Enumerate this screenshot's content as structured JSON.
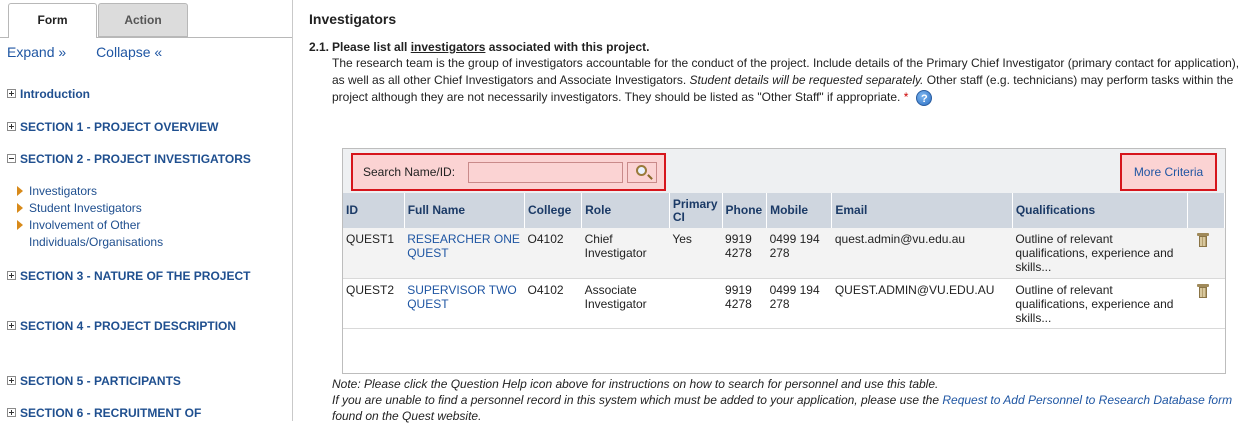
{
  "sidebar": {
    "tabs": {
      "form": "Form",
      "action": "Action"
    },
    "expand": "Expand »",
    "collapse": "Collapse «",
    "sections": [
      {
        "label": "Introduction"
      },
      {
        "label": "SECTION 1 - PROJECT OVERVIEW"
      },
      {
        "label": "SECTION 2 - PROJECT INVESTIGATORS"
      },
      {
        "label": "SECTION 3 - NATURE OF THE PROJECT"
      },
      {
        "label": "SECTION 4 - PROJECT DESCRIPTION"
      },
      {
        "label": "SECTION 5 - PARTICIPANTS"
      },
      {
        "label": "SECTION 6 - RECRUITMENT OF"
      }
    ],
    "sub_items": [
      "Investigators",
      "Student Investigators",
      "Involvement of Other",
      "Individuals/Organisations"
    ]
  },
  "main": {
    "title": "Investigators",
    "question": {
      "number": "2.1.",
      "title_pre": "Please list all ",
      "title_link": "investigators",
      "title_post": " associated with this project.",
      "body_1": "The research team is the group of investigators accountable for the conduct of the project. Include details of the Primary Chief Investigator (primary contact for application), as well as all other Chief Investigators and Associate Investigators. ",
      "body_italic": "Student details will be requested separately.",
      "body_2": " Other staff (e.g. technicians) may perform tasks within the project although they are not necessarily investigators. They should be listed as \"Other Staff\" if appropriate. ",
      "required_mark": "*",
      "help_glyph": "?"
    },
    "search": {
      "label": "Search Name/ID:",
      "value": "",
      "more_criteria": "More Criteria"
    },
    "table": {
      "headers": [
        "ID",
        "Full Name",
        "College",
        "Role",
        "Primary CI",
        "Phone",
        "Mobile",
        "Email",
        "Qualifications",
        ""
      ],
      "rows": [
        {
          "id": "QUEST1",
          "name": "RESEARCHER ONE QUEST",
          "college": "O4102",
          "role": "Chief Investigator",
          "primary": "Yes",
          "phone": "9919 4278",
          "mobile": "0499 194 278",
          "email": "quest.admin@vu.edu.au",
          "qual": "Outline of relevant qualifications, experience and skills..."
        },
        {
          "id": "QUEST2",
          "name": "SUPERVISOR TWO QUEST",
          "college": "O4102",
          "role": "Associate Investigator",
          "primary": "",
          "phone": "9919 4278",
          "mobile": "0499 194 278",
          "email": "QUEST.ADMIN@VU.EDU.AU",
          "qual": "Outline of relevant qualifications, experience and skills..."
        }
      ]
    },
    "note": {
      "line1": "Note: Please click the Question Help icon above for instructions on how to search for personnel and use this table.",
      "line2_pre": "If you are unable to find a personnel record in this system which must be added to your application, please use the ",
      "line2_link": "Request to Add Personnel to Research Database form",
      "line2_post": " found on the Quest website."
    }
  },
  "colors": {
    "link": "#1f56a3",
    "nav": "#1f4f8f",
    "highlight_border": "#d6151c",
    "highlight_fill": "#fbd3d3",
    "header_bg": "#cfd6df"
  },
  "icons": [
    "plus-box-icon",
    "minus-box-icon",
    "triangle-bullet-icon",
    "help-icon",
    "magnifier-icon",
    "trash-icon"
  ]
}
